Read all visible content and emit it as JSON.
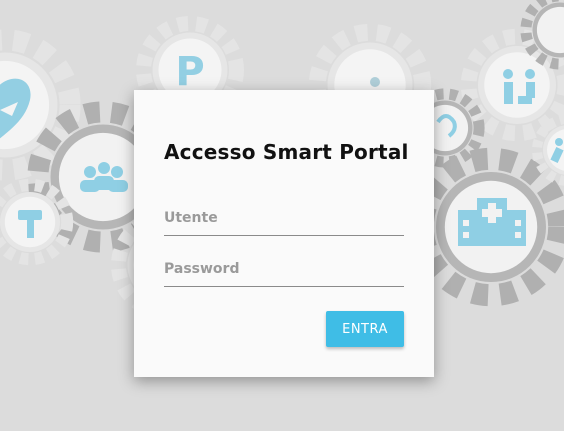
{
  "login": {
    "title": "Accesso Smart Portal",
    "username_placeholder": "Utente",
    "username_value": "",
    "password_placeholder": "Password",
    "password_value": "",
    "submit_label": "ENTRA"
  },
  "background": {
    "parking_letter": "P",
    "icons": [
      "heart-icon",
      "parking-icon",
      "person-icon",
      "people-icon",
      "camera-icon",
      "building-icon",
      "car-icon",
      "hearing-icon",
      "hospital-icon",
      "person-walking-icon",
      "wrench-icon"
    ]
  },
  "colors": {
    "accent": "#3fbde6",
    "icon_blue": "#8fcfe4",
    "gear_gray": "#b8b8b8",
    "background": "#dcdcdc"
  }
}
